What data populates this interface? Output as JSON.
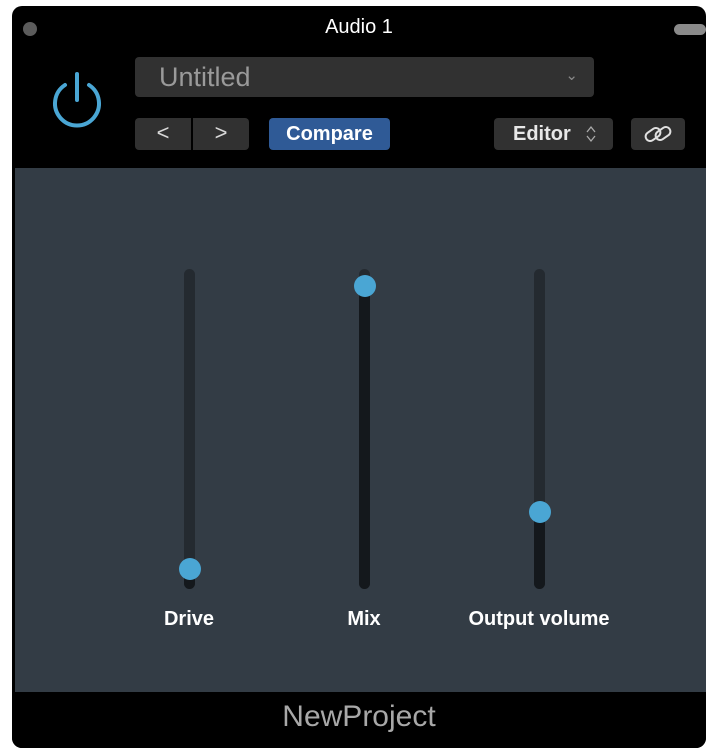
{
  "window": {
    "title": "Audio 1"
  },
  "header": {
    "preset_name": "Untitled",
    "prev_label": "<",
    "next_label": ">",
    "compare_label": "Compare",
    "view_label": "Editor"
  },
  "colors": {
    "accent": "#4aa6d4",
    "compare_bg": "#2f5a96",
    "plugin_bg": "#333c45",
    "power_icon": "#4aa6d4"
  },
  "sliders": [
    {
      "label": "Drive",
      "value": 0.03
    },
    {
      "label": "Mix",
      "value": 0.98
    },
    {
      "label": "Output volume",
      "value": 0.22
    }
  ],
  "footer": {
    "plugin_name": "NewProject"
  }
}
